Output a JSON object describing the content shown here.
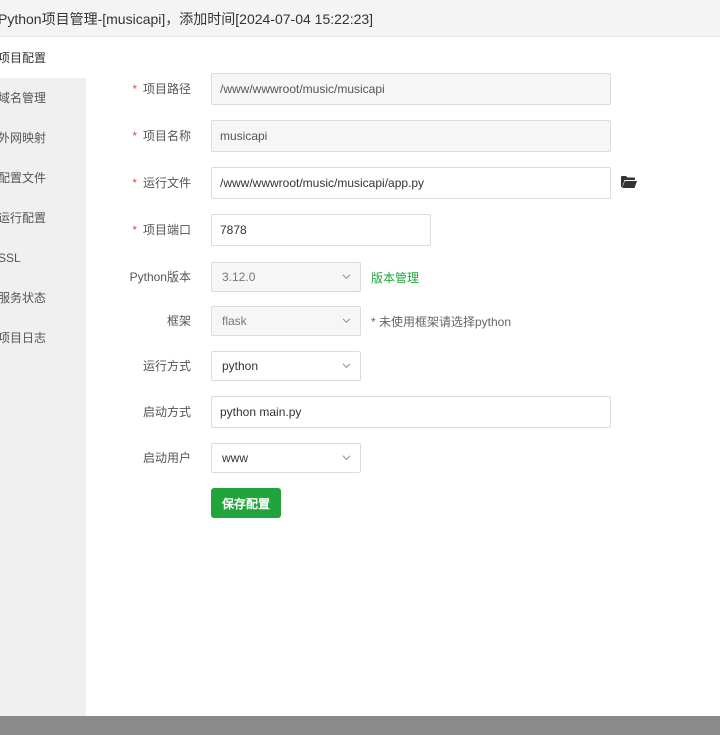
{
  "window": {
    "title": "Python项目管理-[musicapi]，添加时间[2024-07-04 15:22:23]"
  },
  "sidebar": {
    "items": [
      {
        "label": "项目配置"
      },
      {
        "label": "域名管理"
      },
      {
        "label": "外网映射"
      },
      {
        "label": "配置文件"
      },
      {
        "label": "运行配置"
      },
      {
        "label": "SSL"
      },
      {
        "label": "服务状态"
      },
      {
        "label": "项目日志"
      }
    ],
    "active_index": 0
  },
  "form": {
    "project_path": {
      "label": "项目路径",
      "required": true,
      "value": "/www/wwwroot/music/musicapi"
    },
    "project_name": {
      "label": "项目名称",
      "required": true,
      "value": "musicapi"
    },
    "run_file": {
      "label": "运行文件",
      "required": true,
      "value": "/www/wwwroot/music/musicapi/app.py",
      "browse_icon": "folder-open-icon"
    },
    "project_port": {
      "label": "项目端口",
      "required": true,
      "value": "7878"
    },
    "python_version": {
      "label": "Python版本",
      "value": "3.12.0",
      "link": "版本管理"
    },
    "framework": {
      "label": "框架",
      "value": "flask",
      "hint": "* 未使用框架请选择python"
    },
    "run_mode": {
      "label": "运行方式",
      "value": "python"
    },
    "start_command": {
      "label": "启动方式",
      "value": "python main.py"
    },
    "start_user": {
      "label": "启动用户",
      "value": "www"
    },
    "save_label": "保存配置"
  },
  "colors": {
    "accent": "#20a53a",
    "required_mark": "#e74c3c",
    "sidebar_bg": "#f0f0f0",
    "overlay": "#8a8a8a"
  }
}
